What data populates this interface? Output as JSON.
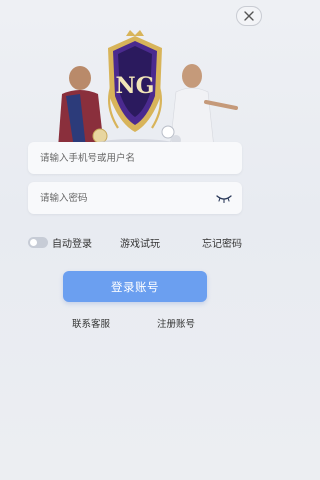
{
  "header": {
    "close_icon": "close-icon"
  },
  "hero": {
    "logo_text": "NG",
    "badge_colors": {
      "purple": "#4b2a8f",
      "gold": "#d8b45a",
      "dark": "#2b1a5e"
    }
  },
  "form": {
    "username_placeholder": "请输入手机号或用户名",
    "password_placeholder": "请输入密码",
    "eye_icon": "eye-closed-icon"
  },
  "options": {
    "auto_login_label": "自动登录",
    "auto_login_on": false,
    "trial_label": "游戏试玩",
    "forgot_label": "忘记密码"
  },
  "actions": {
    "login_label": "登录账号",
    "customer_service_label": "联系客服",
    "register_label": "注册账号"
  },
  "colors": {
    "accent": "#6b9ff0",
    "background": "#eceef2"
  }
}
